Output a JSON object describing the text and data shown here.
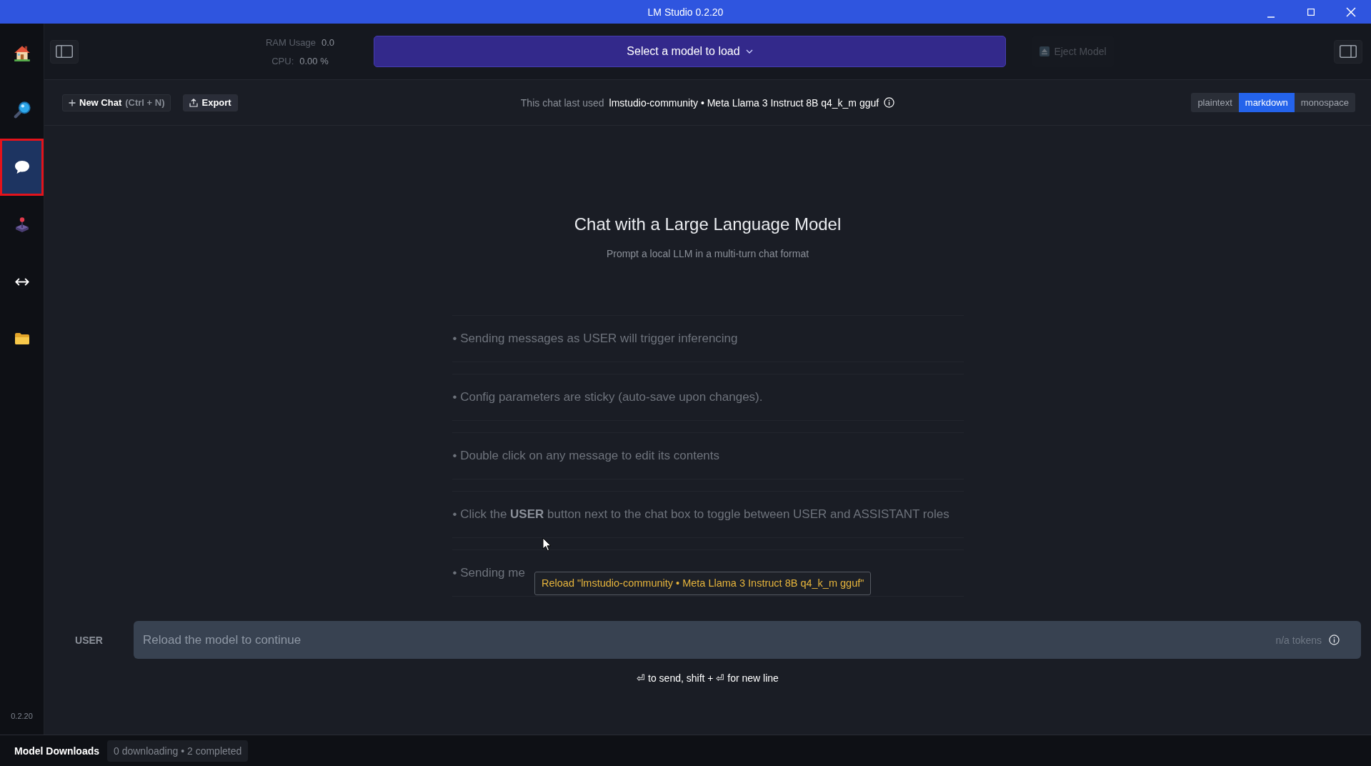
{
  "window": {
    "title": "LM Studio 0.2.20"
  },
  "sidebar": {
    "items": [
      {
        "kind": "home",
        "selected": false
      },
      {
        "kind": "search",
        "selected": false
      },
      {
        "kind": "chat",
        "selected": true
      },
      {
        "kind": "playground",
        "selected": false
      },
      {
        "kind": "server",
        "selected": false
      },
      {
        "kind": "models",
        "selected": false
      }
    ],
    "version": "0.2.20"
  },
  "toolbar": {
    "ram_usage": {
      "label": "RAM Usage",
      "value": "0.0"
    },
    "cpu": {
      "label": "CPU:",
      "value": "0.00 %"
    },
    "model_select": {
      "label": "Select a model to load"
    },
    "eject_button": {
      "label": "Eject Model",
      "disabled": true
    }
  },
  "chat_header": {
    "new_chat": {
      "label": "New Chat",
      "shortcut": "(Ctrl + N)"
    },
    "export": {
      "label": "Export"
    },
    "last_used_label": "This chat last used",
    "last_used_model": "lmstudio-community • Meta Llama 3 Instruct 8B q4_k_m gguf",
    "format_tabs": [
      {
        "label": "plaintext",
        "selected": false
      },
      {
        "label": "markdown",
        "selected": true
      },
      {
        "label": "monospace",
        "selected": false
      }
    ]
  },
  "welcome": {
    "title": "Chat with a Large Language Model",
    "subtitle": "Prompt a local LLM in a multi-turn chat format",
    "tips": [
      "• Sending messages as USER will trigger inferencing",
      "• Config parameters are sticky (auto-save upon changes).",
      "• Double click on any message to edit its contents",
      "• Click the **USER** button next to the chat box to toggle between USER and ASSISTANT roles",
      "• Sending me"
    ]
  },
  "tooltip": {
    "text": "Reload \"lmstudio-community • Meta Llama 3 Instruct 8B q4_k_m gguf\""
  },
  "composer": {
    "role": "USER",
    "placeholder": "Reload the model to continue",
    "tokens": "n/a tokens",
    "hint": "⏎ to send, shift + ⏎ for new line"
  },
  "status_bar": {
    "label": "Model Downloads",
    "summary": "0 downloading • 2 completed"
  }
}
